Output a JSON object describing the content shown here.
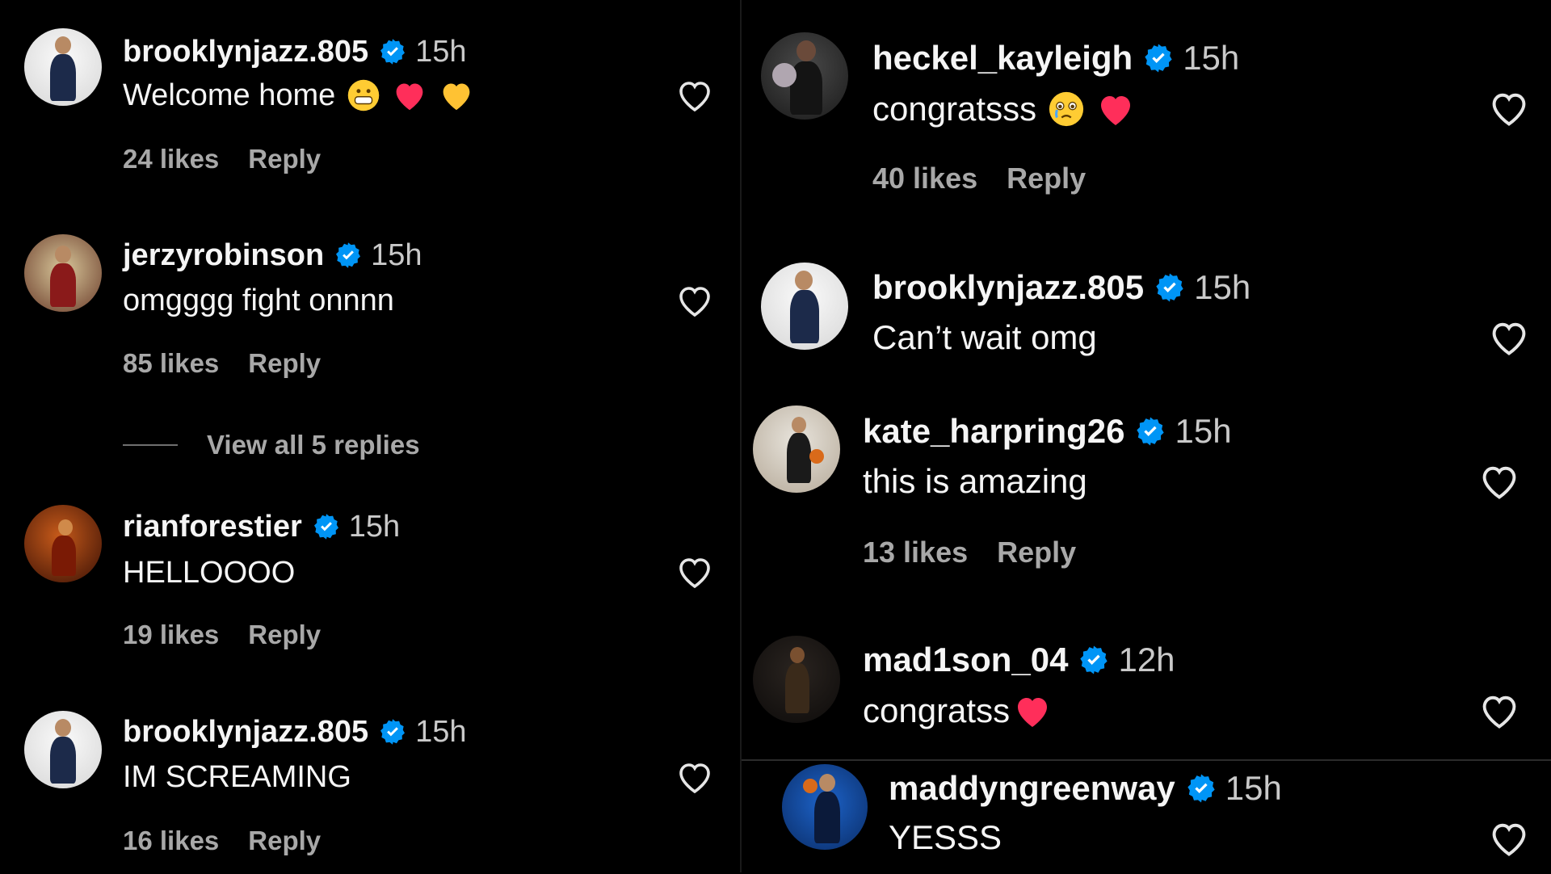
{
  "left": {
    "comments": [
      {
        "username": "brooklynjazz.805",
        "time": "15h",
        "text": "Welcome home",
        "likes": "24 likes",
        "reply": "Reply"
      },
      {
        "username": "jerzyrobinson",
        "time": "15h",
        "text": "omgggg fight onnnn",
        "likes": "85 likes",
        "reply": "Reply",
        "view_replies": "View all 5 replies"
      },
      {
        "username": "rianforestier",
        "time": "15h",
        "text": "HELLOOOO",
        "likes": "19 likes",
        "reply": "Reply"
      },
      {
        "username": "brooklynjazz.805",
        "time": "15h",
        "text": "IM SCREAMING",
        "likes": "16 likes",
        "reply": "Reply"
      }
    ]
  },
  "right": {
    "comments": [
      {
        "username": "heckel_kayleigh",
        "time": "15h",
        "text": "congratsss",
        "likes": "40 likes",
        "reply": "Reply"
      },
      {
        "username": "brooklynjazz.805",
        "time": "15h",
        "text": "Can’t wait omg"
      },
      {
        "username": "kate_harpring26",
        "time": "15h",
        "text": "this is amazing",
        "likes": "13 likes",
        "reply": "Reply"
      },
      {
        "username": "mad1son_04",
        "time": "12h",
        "text": "congratss"
      },
      {
        "username": "maddyngreenway",
        "time": "15h",
        "text": "YESSS"
      }
    ]
  },
  "colors": {
    "background": "#000000",
    "verified": "#0095f6",
    "heart_emoji": "#ff2e5a",
    "secondary_text": "#a8a8a8"
  },
  "icons": [
    "verified-badge-icon",
    "like-heart-icon",
    "grinning-emoji-icon",
    "red-heart-emoji-icon",
    "yellow-heart-emoji-icon",
    "crying-emoji-icon"
  ]
}
